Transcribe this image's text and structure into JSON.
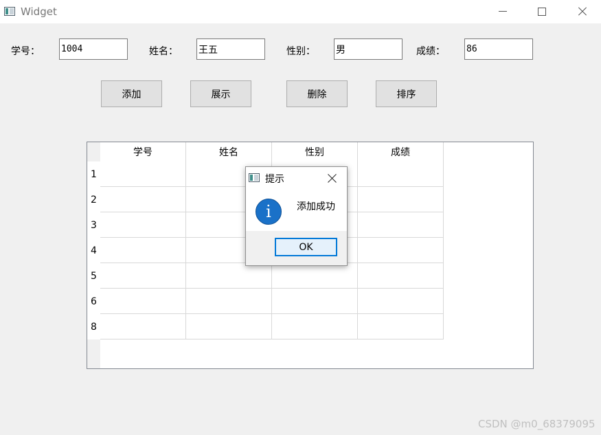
{
  "window": {
    "title": "Widget"
  },
  "form": {
    "id_label": "学号：",
    "id_value": "1004",
    "name_label": "姓名：",
    "name_value": "王五",
    "gender_label": "性别：",
    "gender_value": "男",
    "score_label": "成绩：",
    "score_value": "86"
  },
  "buttons": {
    "add": "添加",
    "show": "展示",
    "delete": "删除",
    "sort": "排序"
  },
  "table": {
    "columns": [
      "学号",
      "姓名",
      "性别",
      "成绩"
    ],
    "row_headers": [
      "1",
      "2",
      "3",
      "4",
      "5",
      "6",
      "8"
    ]
  },
  "dialog": {
    "title": "提示",
    "icon": "information-icon",
    "icon_glyph": "i",
    "message": "添加成功",
    "ok_label": "OK"
  },
  "watermark": "CSDN @m0_68379095"
}
